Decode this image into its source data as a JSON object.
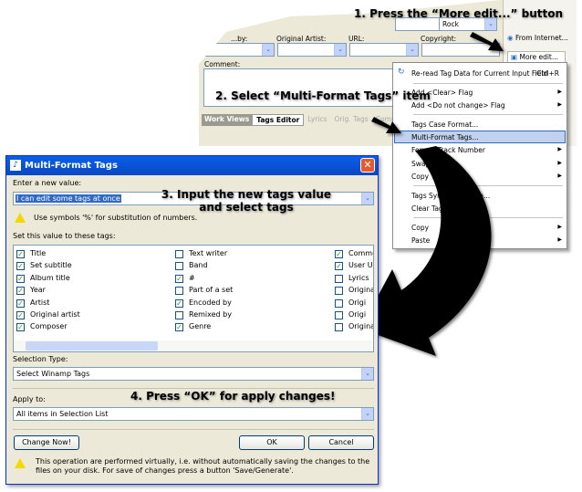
{
  "app": {
    "top_dropdown_value": "Rock",
    "labels": {
      "by": "...by:",
      "original_artist": "Original Artist:",
      "url": "URL:",
      "copyright": "Copyright:",
      "comment": "Comment:"
    },
    "side_buttons": [
      "From Internet...",
      "More edit..."
    ],
    "tabs": [
      "Work Views",
      "Tags Editor",
      "Lyrics",
      "Orig. Tags",
      "Comm"
    ]
  },
  "menu": {
    "items": [
      {
        "label": "Re-read Tag Data for Current Input Field",
        "shortcut": "Ctrl+R"
      },
      {
        "label": "Add <Clear> Flag",
        "submenu": true
      },
      {
        "label": "Add <Do not change> Flag",
        "submenu": true
      },
      {
        "label": "Tags Case Format..."
      },
      {
        "label": "Multi-Format Tags...",
        "highlighted": true
      },
      {
        "label": "Format Track Number",
        "submenu": true
      },
      {
        "label": "Swap Tags",
        "submenu": true
      },
      {
        "label": "Copy Tag to Tag",
        "submenu": true
      },
      {
        "label": "Tags Synchronization..."
      },
      {
        "label": "Clear Tags..."
      },
      {
        "label": "Copy",
        "submenu": true
      },
      {
        "label": "Paste",
        "submenu": true
      }
    ]
  },
  "dialog": {
    "title": "Multi-Format Tags",
    "enter_label": "Enter a new value:",
    "value": "I can edit some tags at once",
    "hint": "Use symbols '%' for substitution of numbers.",
    "set_label": "Set this value to these tags:",
    "columns": [
      [
        {
          "l": "Title",
          "c": true
        },
        {
          "l": "Set subtitle",
          "c": true
        },
        {
          "l": "Album title",
          "c": true
        },
        {
          "l": "Year",
          "c": true
        },
        {
          "l": "Artist",
          "c": true
        },
        {
          "l": "Original artist",
          "c": true
        },
        {
          "l": "Composer",
          "c": true
        }
      ],
      [
        {
          "l": "Text writer",
          "c": false
        },
        {
          "l": "Band",
          "c": false
        },
        {
          "l": "#",
          "c": true
        },
        {
          "l": "Part of a set",
          "c": false
        },
        {
          "l": "Encoded by",
          "c": true
        },
        {
          "l": "Remixed by",
          "c": false
        },
        {
          "l": "Genre",
          "c": true
        }
      ],
      [
        {
          "l": "Commen",
          "c": true
        },
        {
          "l": "User UR",
          "c": true
        },
        {
          "l": "Lyrics",
          "c": false
        },
        {
          "l": "Original",
          "c": false
        },
        {
          "l": "Origi",
          "c": false
        },
        {
          "l": "Origi",
          "c": false
        },
        {
          "l": "Original",
          "c": false
        }
      ]
    ],
    "selection_type_label": "Selection Type:",
    "selection_type": "Select Winamp Tags",
    "apply_label": "Apply to:",
    "apply_to": "All items in Selection List",
    "change_now": "Change Now!",
    "ok": "OK",
    "cancel": "Cancel",
    "footer": "This operation are performed virtually, i.e. without automatically saving the changes to the files on your disk. For save of changes press a button 'Save/Generate'."
  },
  "annotations": [
    "1. Press the “More edit...” button",
    "2. Select “Multi-Format Tags” item",
    "3. Input the new tags value and select tags",
    "4. Press “OK” for apply changes!"
  ]
}
